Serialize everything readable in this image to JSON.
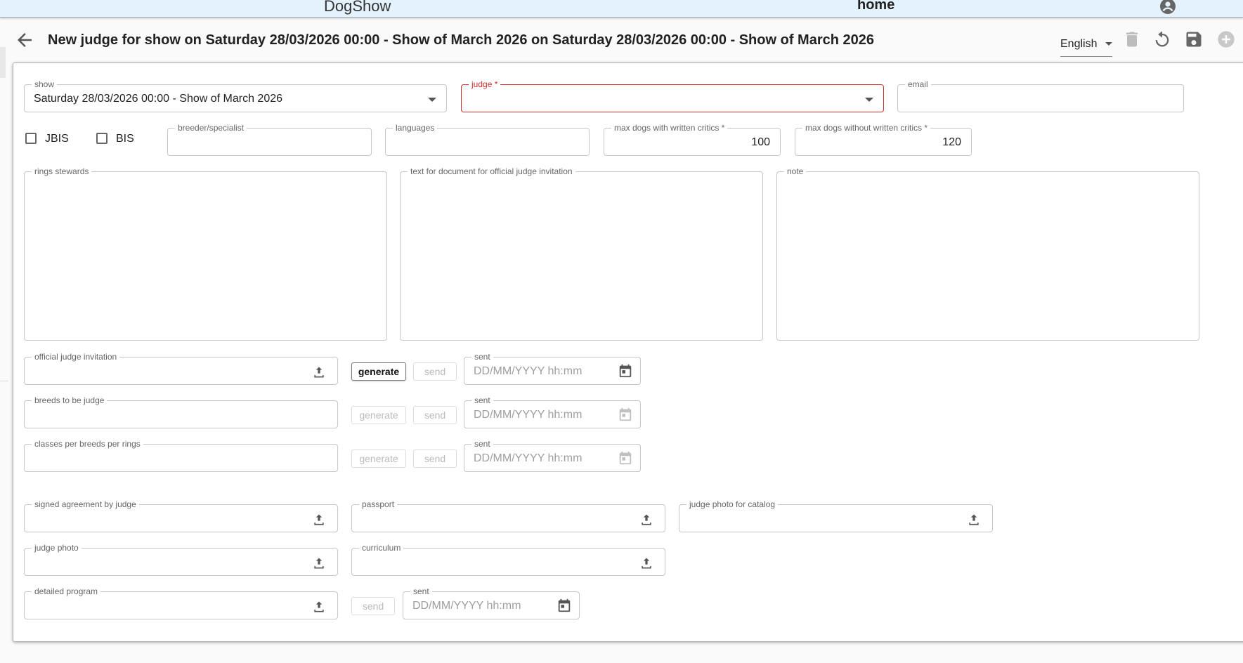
{
  "app": {
    "title": "DogShow",
    "home_link": "home"
  },
  "header": {
    "title": "New judge for show on Saturday 28/03/2026 00:00 - Show of March 2026 on Saturday 28/03/2026 00:00 - Show of March 2026",
    "language": "English"
  },
  "icons": {
    "account": "account-circle-icon",
    "back": "arrow-back-icon",
    "delete": "delete-icon",
    "undo": "undo-icon",
    "save": "save-icon",
    "add": "add-circle-icon",
    "upload": "upload-icon",
    "calendar": "calendar-icon"
  },
  "colors": {
    "error": "#d32f2f",
    "topbar": "#e3f2fd"
  },
  "form": {
    "show": {
      "label": "show",
      "value": "Saturday 28/03/2026 00:00 - Show of March 2026"
    },
    "judge": {
      "label": "judge *",
      "value": ""
    },
    "email": {
      "label": "email",
      "value": ""
    },
    "jbis": {
      "label": "JBIS",
      "checked": false
    },
    "bis": {
      "label": "BIS",
      "checked": false
    },
    "breeder_specialist": {
      "label": "breeder/specialist",
      "value": ""
    },
    "languages": {
      "label": "languages",
      "value": ""
    },
    "max_with": {
      "label": "max dogs with written critics *",
      "value": "100"
    },
    "max_without": {
      "label": "max dogs without written critics *",
      "value": "120"
    },
    "rings_stewards": {
      "label": "rings stewards",
      "value": ""
    },
    "invitation_text": {
      "label": "text for document for official judge invitation",
      "value": ""
    },
    "note": {
      "label": "note",
      "value": ""
    },
    "official_invitation": {
      "label": "official judge invitation"
    },
    "breeds_to_judge": {
      "label": "breeds to be judge"
    },
    "classes_per_breeds": {
      "label": "classes per breeds per rings"
    },
    "signed_agreement": {
      "label": "signed agreement by judge"
    },
    "passport": {
      "label": "passport"
    },
    "judge_photo_catalog": {
      "label": "judge photo for catalog"
    },
    "judge_photo": {
      "label": "judge photo"
    },
    "curriculum": {
      "label": "curriculum"
    },
    "detailed_program": {
      "label": "detailed program"
    },
    "sent": {
      "label": "sent",
      "placeholder": "DD/MM/YYYY hh:mm"
    },
    "buttons": {
      "generate": "generate",
      "send": "send"
    }
  }
}
